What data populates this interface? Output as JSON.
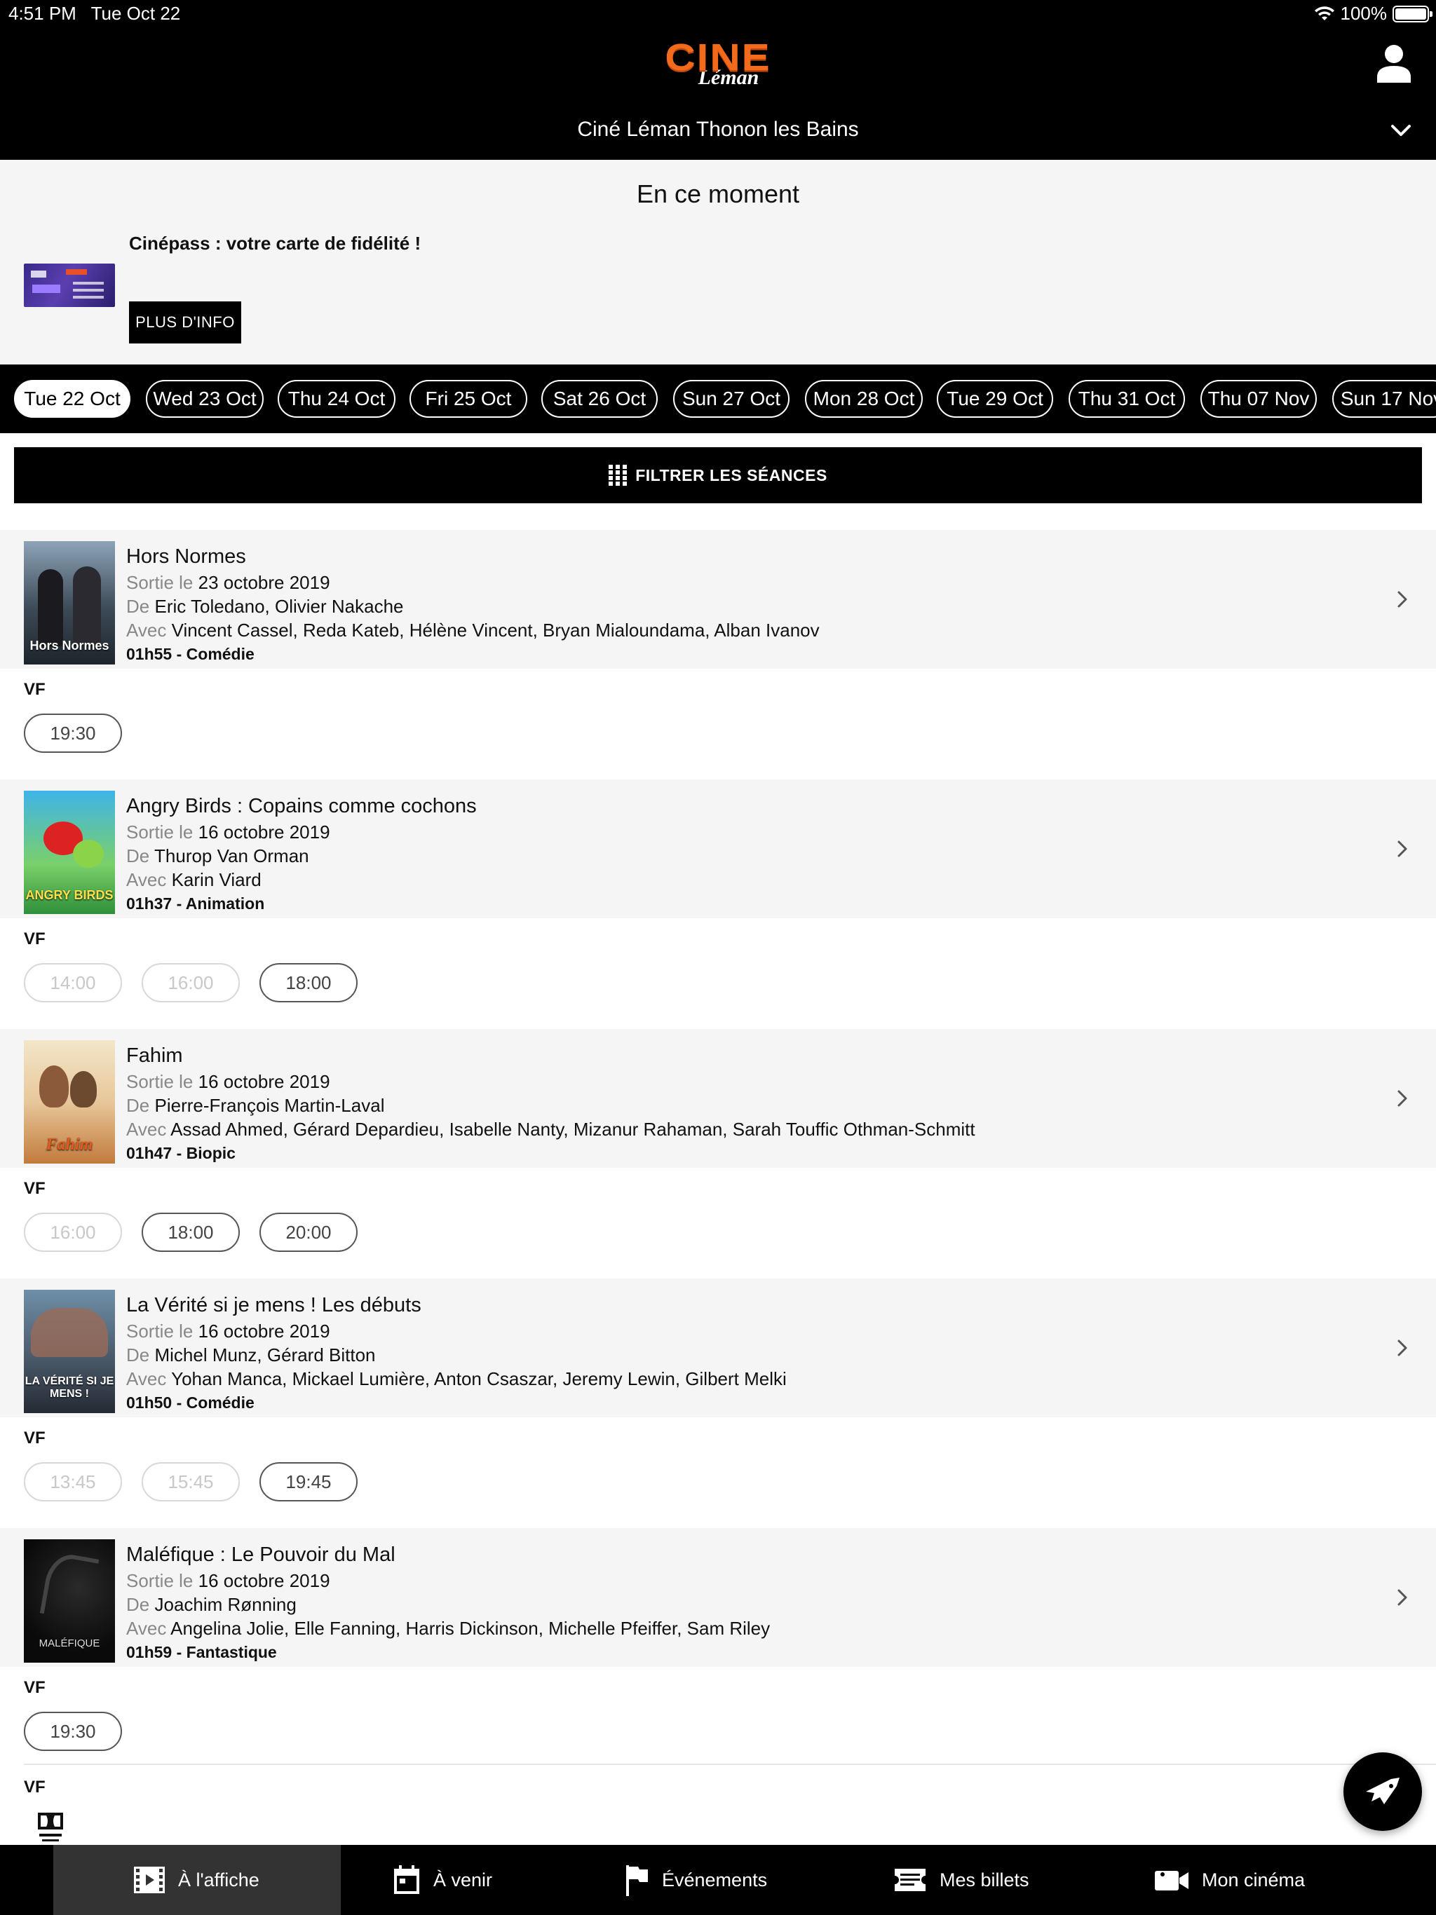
{
  "status_bar": {
    "time": "4:51 PM",
    "date": "Tue Oct 22",
    "battery": "100%"
  },
  "header": {
    "logo_primary": "CINE",
    "logo_secondary": "Léman",
    "cinema_name": "Ciné Léman Thonon les Bains"
  },
  "promo": {
    "section_title": "En ce moment",
    "headline": "Cinépass : votre carte de fidélité !",
    "button_label": "PLUS D'INFO"
  },
  "dates": [
    {
      "label": "Tue 22 Oct",
      "active": true
    },
    {
      "label": "Wed 23 Oct",
      "active": false
    },
    {
      "label": "Thu 24 Oct",
      "active": false
    },
    {
      "label": "Fri 25 Oct",
      "active": false
    },
    {
      "label": "Sat 26 Oct",
      "active": false
    },
    {
      "label": "Sun 27 Oct",
      "active": false
    },
    {
      "label": "Mon 28 Oct",
      "active": false
    },
    {
      "label": "Tue 29 Oct",
      "active": false
    },
    {
      "label": "Thu 31 Oct",
      "active": false
    },
    {
      "label": "Thu 07 Nov",
      "active": false
    },
    {
      "label": "Sun 17 Nov",
      "active": false
    }
  ],
  "filter": {
    "label": "FILTRER LES SÉANCES"
  },
  "labels": {
    "release": "Sortie le",
    "director": "De",
    "cast": "Avec"
  },
  "movies": [
    {
      "title": "Hors Normes",
      "poster_text": "Hors Normes",
      "release_date": "23 octobre 2019",
      "directors": "Eric Toledano, Olivier Nakache",
      "cast": "Vincent Cassel, Reda Kateb, Hélène Vincent, Bryan Mialoundama, Alban Ivanov",
      "duration_genre": "01h55 - Comédie",
      "version": "VF",
      "showtimes": [
        {
          "time": "19:30",
          "available": true
        }
      ]
    },
    {
      "title": "Angry Birds : Copains comme cochons",
      "poster_text": "ANGRY BIRDS",
      "release_date": "16 octobre 2019",
      "directors": "Thurop Van Orman",
      "cast": "Karin Viard",
      "duration_genre": "01h37 - Animation",
      "version": "VF",
      "showtimes": [
        {
          "time": "14:00",
          "available": false
        },
        {
          "time": "16:00",
          "available": false
        },
        {
          "time": "18:00",
          "available": true
        }
      ]
    },
    {
      "title": "Fahim",
      "poster_text": "Fahim",
      "release_date": "16 octobre 2019",
      "directors": "Pierre-François Martin-Laval",
      "cast": "Assad Ahmed, Gérard Depardieu, Isabelle Nanty, Mizanur Rahaman, Sarah Touffic Othman-Schmitt",
      "duration_genre": "01h47 - Biopic",
      "version": "VF",
      "showtimes": [
        {
          "time": "16:00",
          "available": false
        },
        {
          "time": "18:00",
          "available": true
        },
        {
          "time": "20:00",
          "available": true
        }
      ]
    },
    {
      "title": "La Vérité si je mens ! Les débuts",
      "poster_text": "LA VÉRITÉ SI JE MENS !",
      "release_date": "16 octobre 2019",
      "directors": "Michel Munz, Gérard Bitton",
      "cast": "Yohan Manca, Mickael Lumière, Anton Csaszar, Jeremy Lewin, Gilbert Melki",
      "duration_genre": "01h50 - Comédie",
      "version": "VF",
      "showtimes": [
        {
          "time": "13:45",
          "available": false
        },
        {
          "time": "15:45",
          "available": false
        },
        {
          "time": "19:45",
          "available": true
        }
      ]
    },
    {
      "title": "Maléfique : Le Pouvoir du Mal",
      "poster_text": "MALÉFIQUE",
      "release_date": "16 octobre 2019",
      "directors": "Joachim Rønning",
      "cast": "Angelina Jolie, Elle Fanning, Harris Dickinson, Michelle Pfeiffer, Sam Riley",
      "duration_genre": "01h59 - Fantastique",
      "version": "VF",
      "showtimes": [
        {
          "time": "19:30",
          "available": true
        }
      ]
    }
  ],
  "extra_version": {
    "version": "VF",
    "badge_icon": "dolby-atmos-icon"
  },
  "tabs": [
    {
      "label": "À l'affiche",
      "icon": "film-icon",
      "active": true
    },
    {
      "label": "À venir",
      "icon": "calendar-icon",
      "active": false
    },
    {
      "label": "Événements",
      "icon": "flag-icon",
      "active": false
    },
    {
      "label": "Mes billets",
      "icon": "ticket-icon",
      "active": false
    },
    {
      "label": "Mon cinéma",
      "icon": "camera-icon",
      "active": false
    }
  ],
  "colors": {
    "brand_orange": "#f26a1b",
    "header_bg": "#000000",
    "panel_bg": "#f5f5f5",
    "active_tab_bg": "#333333"
  }
}
